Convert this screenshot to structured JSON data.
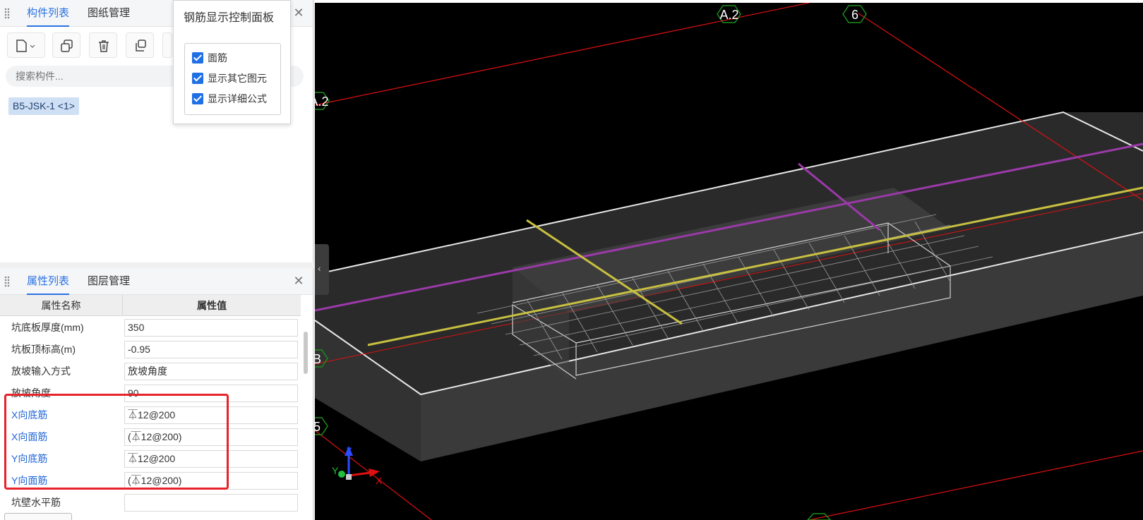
{
  "component_panel": {
    "tabs": [
      "构件列表",
      "图纸管理"
    ],
    "search_placeholder": "搜索构件...",
    "items": [
      "B5-JSK-1 <1>"
    ]
  },
  "property_panel": {
    "tabs": [
      "属性列表",
      "图层管理"
    ],
    "headers": {
      "name": "属性名称",
      "value": "属性值"
    },
    "rows": [
      {
        "name": "坑底板厚度(mm)",
        "value": "350"
      },
      {
        "name": "坑板顶标高(m)",
        "value": "-0.95"
      },
      {
        "name": "放坡输入方式",
        "value": "放坡角度"
      },
      {
        "name": "放坡角度",
        "value": "90"
      },
      {
        "name": "X向底筋",
        "value": "⏄12@200"
      },
      {
        "name": "X向面筋",
        "value": "(⏄12@200)"
      },
      {
        "name": "Y向底筋",
        "value": "⏄12@200"
      },
      {
        "name": "Y向面筋",
        "value": "(⏄12@200)"
      },
      {
        "name": "坑壁水平筋",
        "value": ""
      }
    ]
  },
  "rebar_panel": {
    "title": "钢筋显示控制面板",
    "options": [
      {
        "label": "面筋",
        "checked": true
      },
      {
        "label": "显示其它图元",
        "checked": true
      },
      {
        "label": "显示详细公式",
        "checked": true
      }
    ]
  },
  "viewport": {
    "axis_labels": {
      "a2_top": "A.2",
      "six": "6",
      "a2_left": "A.2",
      "b": "B",
      "five": "5"
    },
    "triad": {
      "x": "X",
      "y": "Y",
      "z": "Z"
    }
  },
  "colors": {
    "accent": "#2b73e0",
    "highlight": "#e8222a",
    "grid": "#e01010",
    "rebar_yellow": "#c8c040",
    "rebar_purple": "#9a3aa8"
  }
}
